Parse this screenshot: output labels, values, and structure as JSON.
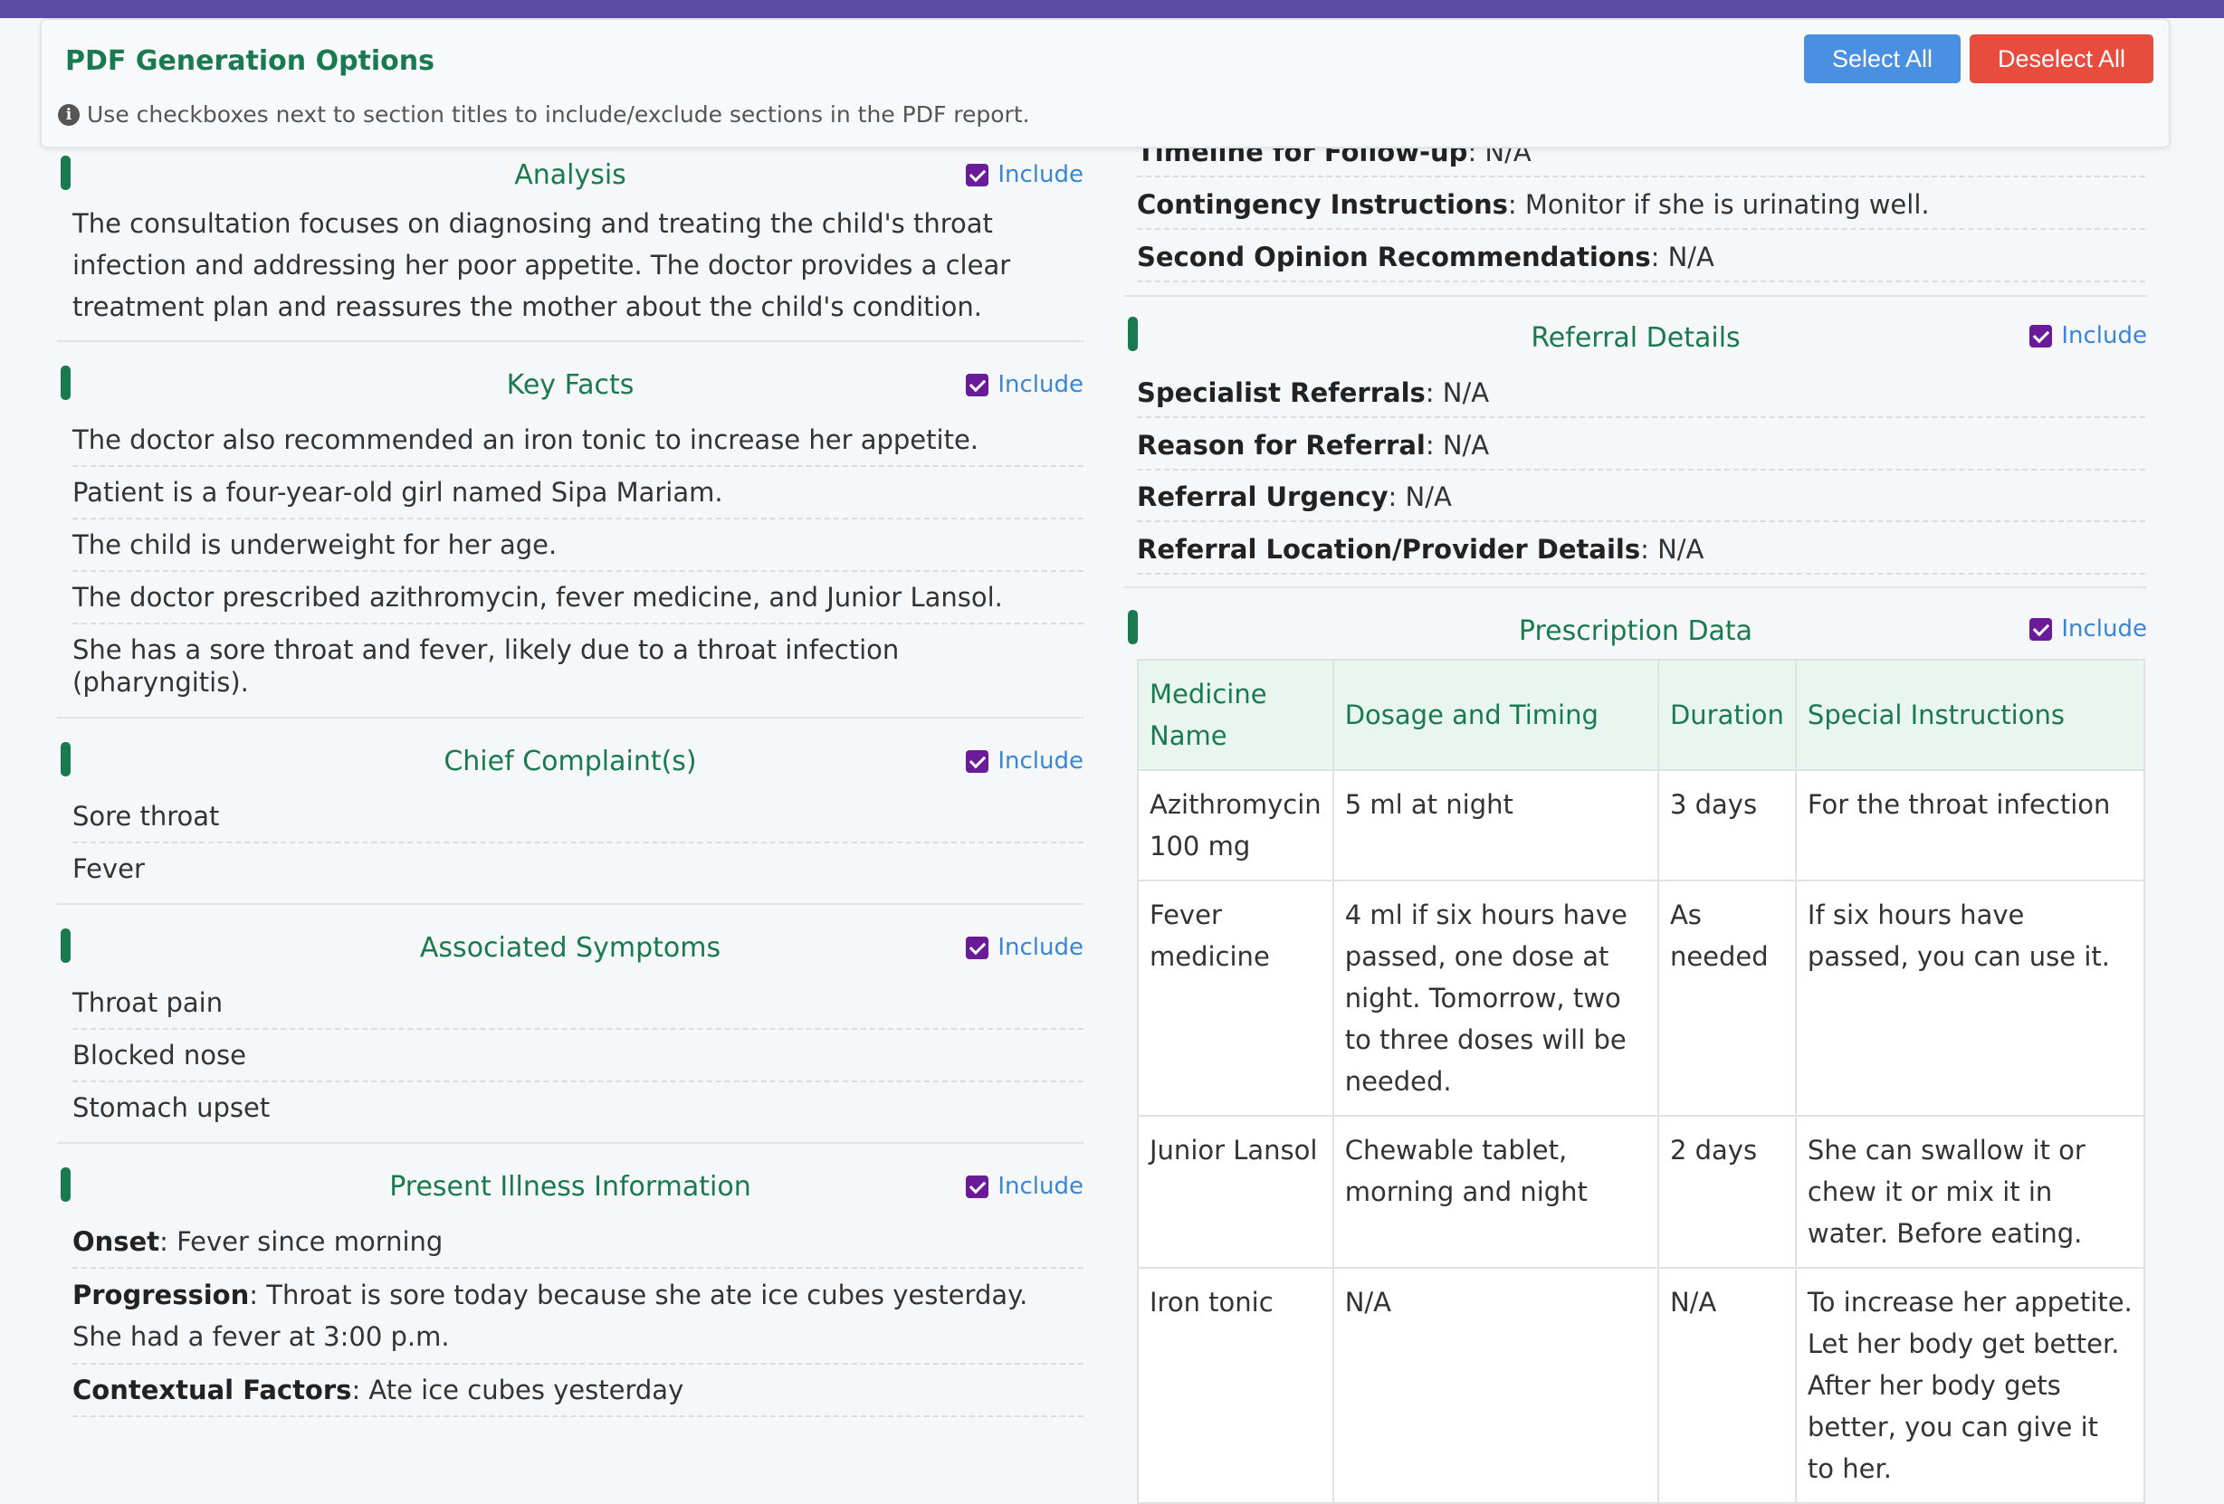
{
  "options_panel": {
    "title": "PDF Generation Options",
    "hint": "Use checkboxes next to section titles to include/exclude sections in the PDF report.",
    "select_all_label": "Select All",
    "deselect_all_label": "Deselect All"
  },
  "include_label": "Include",
  "colors": {
    "accent_green": "#1a7a4f",
    "checkbox": "#6a1b9a",
    "include_link": "#3a86d4",
    "select_all": "#4a90e2",
    "deselect_all": "#e74c3c",
    "top_bar": "#5b4aa3"
  },
  "left": {
    "analysis": {
      "title": "Analysis",
      "text": "The consultation focuses on diagnosing and treating the child's throat infection and addressing her poor appetite. The doctor provides a clear treatment plan and reassures the mother about the child's condition."
    },
    "key_facts": {
      "title": "Key Facts",
      "items": [
        "The doctor also recommended an iron tonic to increase her appetite.",
        "Patient is a four-year-old girl named Sipa Mariam.",
        "The child is underweight for her age.",
        "The doctor prescribed azithromycin, fever medicine, and Junior Lansol.",
        "She has a sore throat and fever, likely due to a throat infection (pharyngitis)."
      ]
    },
    "chief_complaints": {
      "title": "Chief Complaint(s)",
      "items": [
        "Sore throat",
        "Fever"
      ]
    },
    "associated_symptoms": {
      "title": "Associated Symptoms",
      "items": [
        "Throat pain",
        "Blocked nose",
        "Stomach upset"
      ]
    },
    "present_illness": {
      "title": "Present Illness Information",
      "onset_key": "Onset",
      "onset_val": ": Fever since morning",
      "progression_key": "Progression",
      "progression_val": ": Throat is sore today because she ate ice cubes yesterday. She had a fever at 3:00 p.m.",
      "contextual_key": "Contextual Factors",
      "contextual_val": ": Ate ice cubes yesterday"
    }
  },
  "right": {
    "followup": {
      "timeline_key": "Timeline for Follow-up",
      "timeline_val": ": N/A",
      "contingency_key": "Contingency Instructions",
      "contingency_val": ": Monitor if she is urinating well.",
      "second_opinion_key": "Second Opinion Recommendations",
      "second_opinion_val": ": N/A"
    },
    "referral": {
      "title": "Referral Details",
      "specialist_key": "Specialist Referrals",
      "specialist_val": ": N/A",
      "reason_key": "Reason for Referral",
      "reason_val": ": N/A",
      "urgency_key": "Referral Urgency",
      "urgency_val": ": N/A",
      "location_key": "Referral Location/Provider Details",
      "location_val": ": N/A"
    },
    "prescription": {
      "title": "Prescription Data",
      "headers": [
        "Medicine Name",
        "Dosage and Timing",
        "Duration",
        "Special Instructions"
      ],
      "rows": [
        [
          "Azithromycin 100 mg",
          "5 ml at night",
          "3 days",
          "For the throat infection"
        ],
        [
          "Fever medicine",
          "4 ml if six hours have passed, one dose at night. Tomorrow, two to three doses will be needed.",
          "As needed",
          "If six hours have passed, you can use it."
        ],
        [
          "Junior Lansol",
          "Chewable tablet, morning and night",
          "2 days",
          "She can swallow it or chew it or mix it in water. Before eating."
        ],
        [
          "Iron tonic",
          "N/A",
          "N/A",
          "To increase her appetite. Let her body get better. After her body gets better, you can give it to her."
        ]
      ]
    }
  }
}
